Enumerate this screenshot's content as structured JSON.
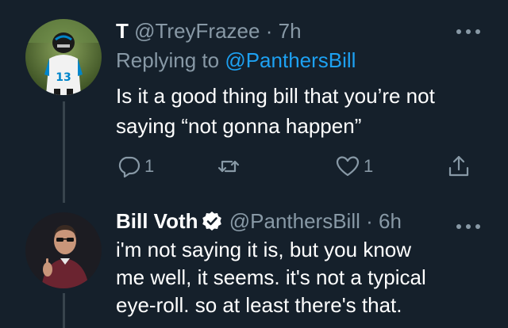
{
  "tweets": [
    {
      "display_name": "T",
      "handle": "@TreyFrazee",
      "separator": "·",
      "time": "7h",
      "replying_prefix": "Replying to",
      "replying_to": "@PanthersBill",
      "text_lines": [
        "Is it a good thing bill that you’re not",
        "saying “not gonna happen”"
      ],
      "reply_count": "1",
      "retweet_count": "",
      "like_count": "1"
    },
    {
      "display_name": "Bill Voth",
      "verified": true,
      "handle": "@PanthersBill",
      "separator": "·",
      "time": "6h",
      "text_lines": [
        "i'm not saying it is, but you know",
        "me well, it seems. it's not a typical",
        "eye-roll. so at least there's that."
      ]
    }
  ],
  "icons": {
    "more": "more-dots-icon",
    "reply": "reply-bubble-icon",
    "retweet": "retweet-icon",
    "like": "heart-icon",
    "share": "share-icon",
    "verified": "verified-badge-icon"
  },
  "colors": {
    "background": "#15202b",
    "secondary_text": "#8899a6",
    "link": "#1da1f2",
    "thread_line": "#38444d"
  }
}
